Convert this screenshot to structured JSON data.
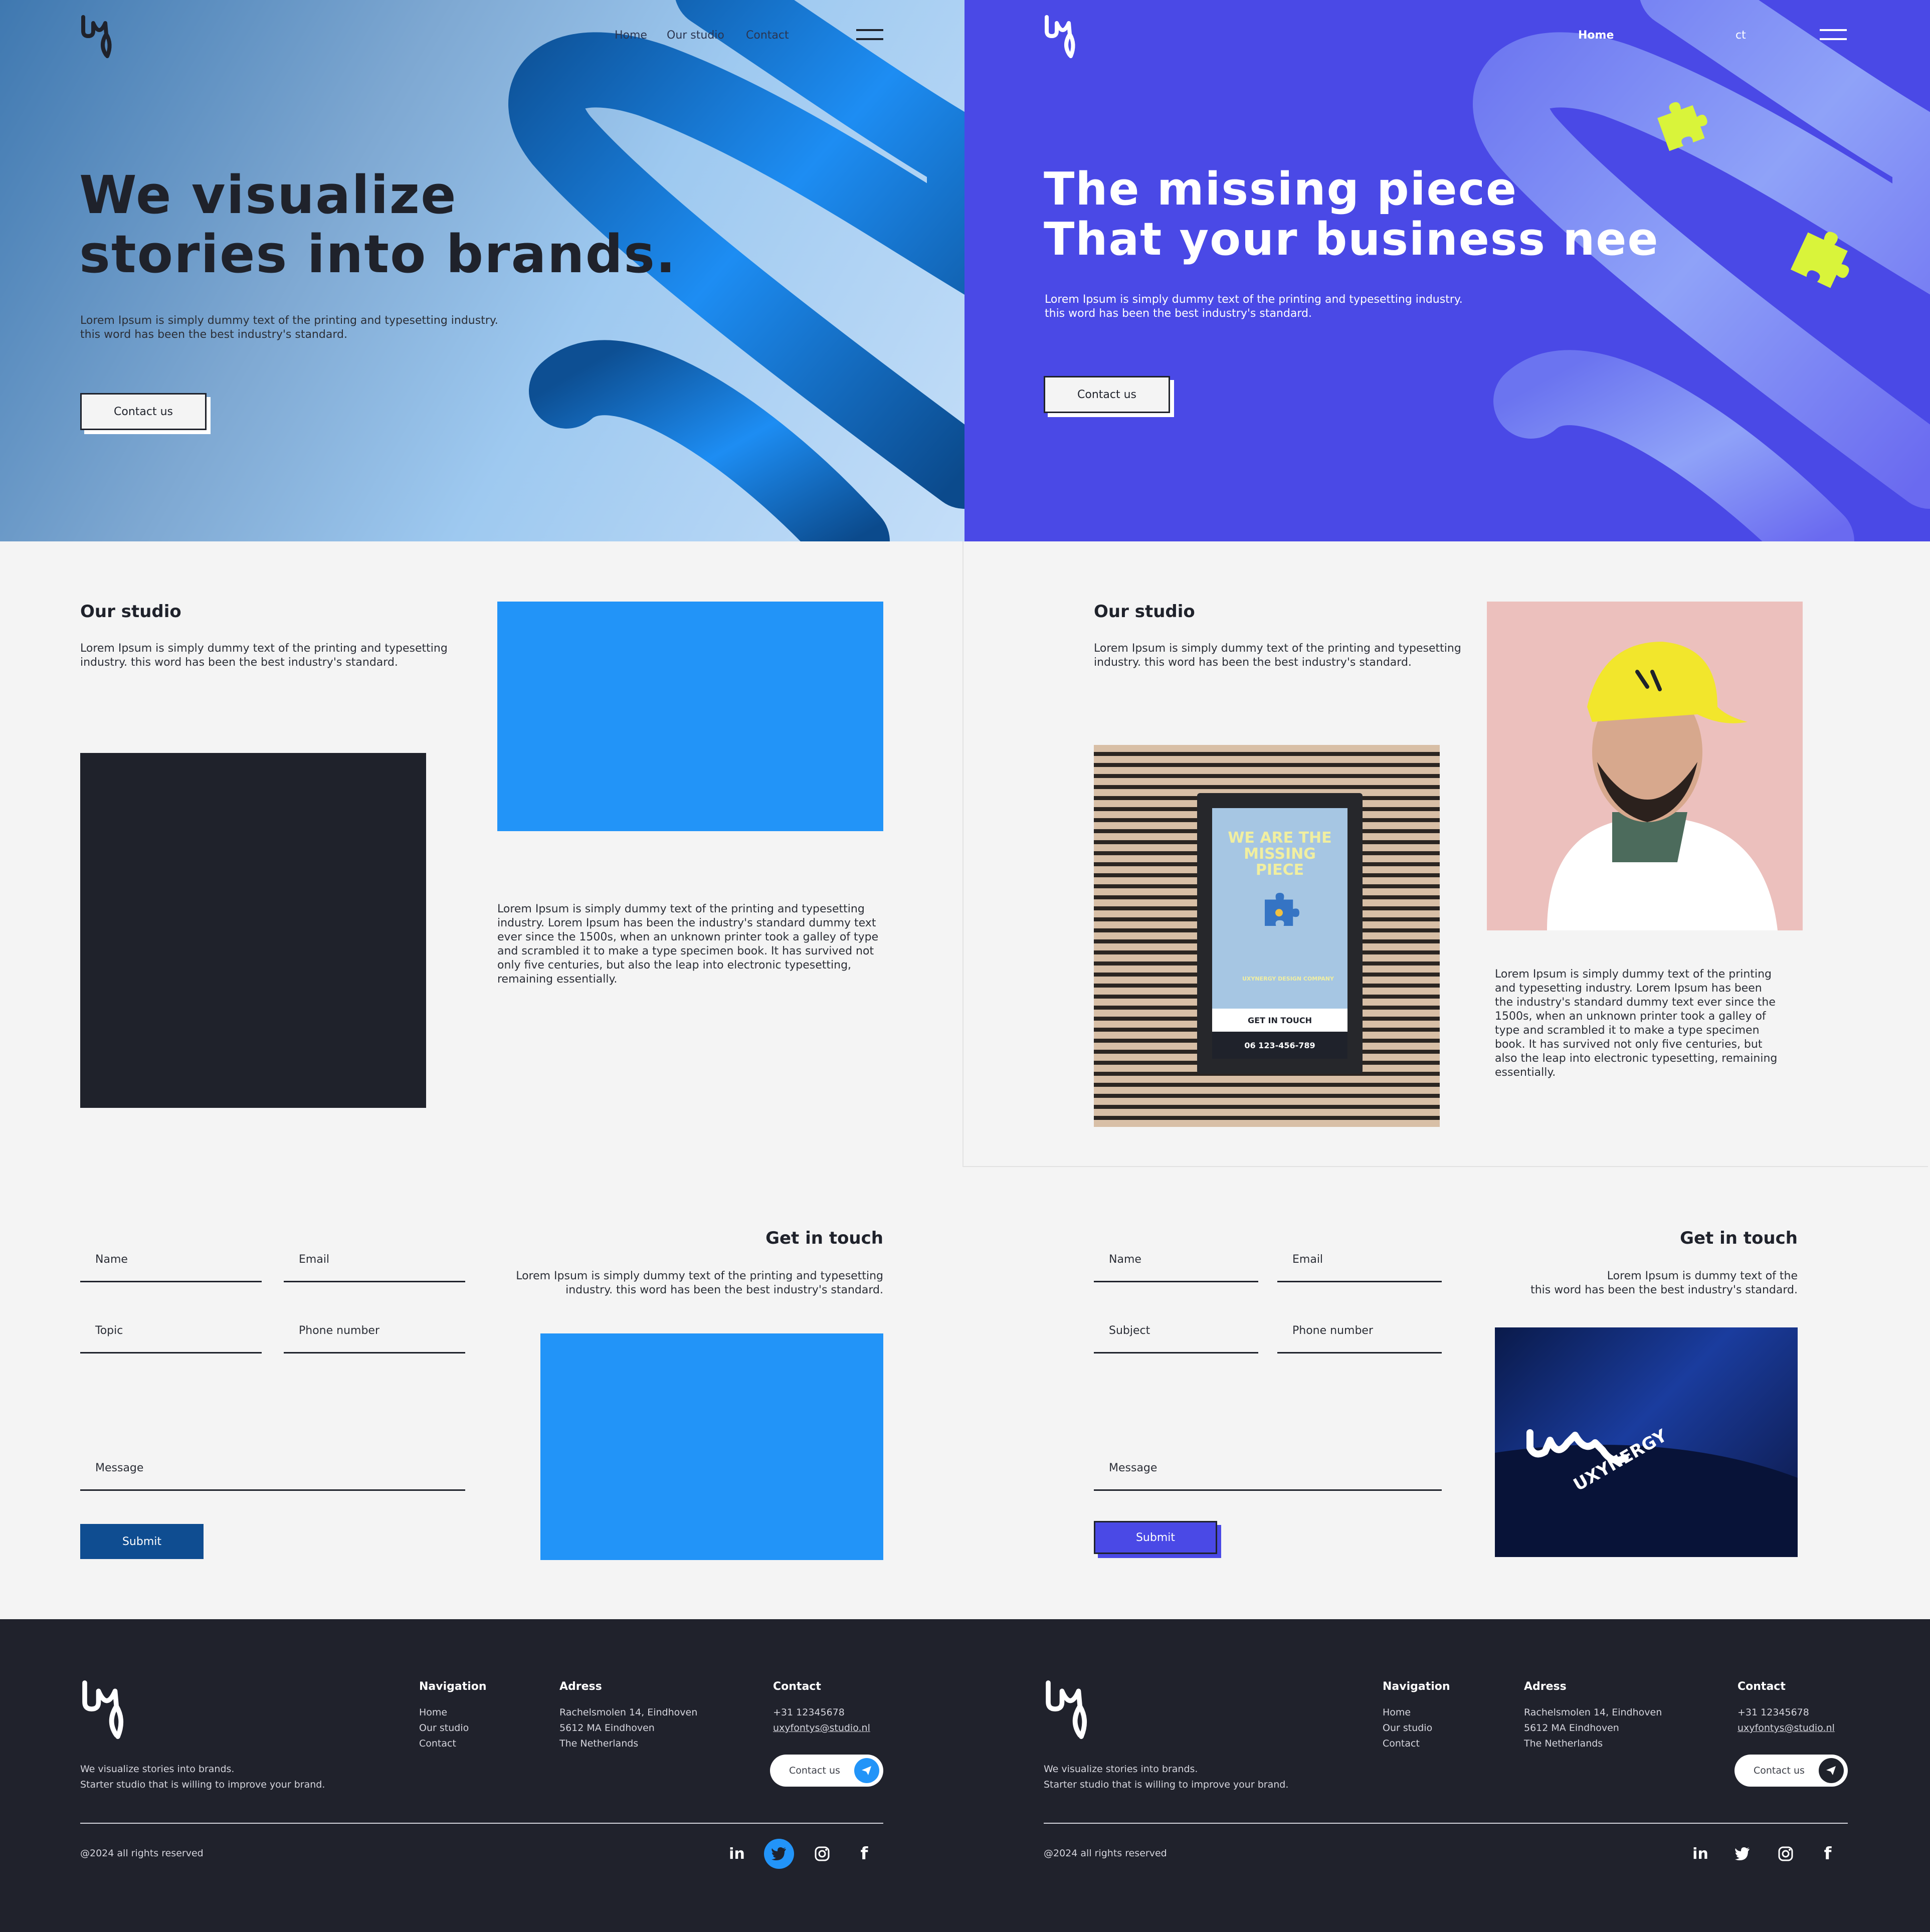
{
  "brand": {
    "logo": "uxy"
  },
  "colors": {
    "dark": "#1f222b",
    "blue": "#2294f8",
    "navy": "#0f4d91",
    "purple": "#4a49e6",
    "lime": "#d9f43a"
  },
  "left": {
    "nav": {
      "home": "Home",
      "studio": "Our studio",
      "contact": "Contact"
    },
    "hero": {
      "line1": "We visualize",
      "line2": "stories into brands.",
      "body1": "Lorem Ipsum is simply dummy text of the printing and typesetting industry.",
      "body2": "this word has been the best industry's standard.",
      "cta": "Contact us"
    },
    "studio": {
      "title": "Our studio",
      "body1": "Lorem Ipsum is simply dummy text of the printing and typesetting",
      "body2": "industry. this word has been the best industry's standard.",
      "long": "Lorem Ipsum is simply dummy text of the printing and typesetting industry. Lorem Ipsum has been the industry's standard dummy text ever since the 1500s, when an unknown printer took a galley of type and scrambled it to make a type specimen book. It has survived not only five centuries, but also the leap into electronic typesetting, remaining essentially."
    },
    "form": {
      "name": "Name",
      "email": "Email",
      "topic": "Topic",
      "phone": "Phone number",
      "message": "Message",
      "submit": "Submit"
    },
    "touch": {
      "title": "Get in touch",
      "body1": "Lorem Ipsum is simply dummy text of the printing and typesetting",
      "body2": "industry. this word has been the best industry's standard."
    }
  },
  "right": {
    "nav": {
      "home": "Home",
      "contact_fragment": "ct"
    },
    "hero": {
      "line1": "The missing piece",
      "line2": "That your business nee",
      "body1": "Lorem Ipsum is simply dummy text of the printing and typesetting industry.",
      "body2": "this word has been the best industry's standard.",
      "cta": "Contact us"
    },
    "studio": {
      "title": "Our studio",
      "body1": "Lorem Ipsum is simply dummy text of the printing and typesetting",
      "body2": "industry. this word has been the best industry's standard.",
      "long": "Lorem Ipsum is simply dummy text of the printing and typesetting industry. Lorem Ipsum has been the industry's standard dummy text ever since the 1500s, when an unknown printer took a galley of type and scrambled it to make a type specimen book. It has survived not only five centuries, but also the leap into electronic typesetting, remaining essentially."
    },
    "poster": {
      "headline": "WE ARE THE MISSING PIECE",
      "company": "UXYNERGY DESIGN COMPANY",
      "cta": "GET IN TOUCH",
      "phone": "06 123-456-789"
    },
    "form": {
      "name": "Name",
      "email": "Email",
      "subject": "Subject",
      "phone": "Phone number",
      "message": "Message",
      "submit": "Submit"
    },
    "touch": {
      "title": "Get in touch",
      "body1": "Lorem Ipsum is dummy text of the",
      "body2": "this word has been the best industry's standard."
    },
    "card": {
      "brand": "UXYNERGY"
    }
  },
  "footer": {
    "tagline1": "We visualize stories into brands.",
    "tagline2": "Starter studio that is willing to improve your brand.",
    "nav_title": "Navigation",
    "nav_items": [
      "Home",
      "Our studio",
      "Contact"
    ],
    "address_title": "Adress",
    "address_lines": [
      "Rachelsmolen 14, Eindhoven",
      "5612 MA Eindhoven",
      "The Netherlands"
    ],
    "contact_title": "Contact",
    "phone": "+31 12345678",
    "email": "uxyfontys@studio.nl",
    "contact_btn": "Contact us",
    "copyright": "@2024 all rights reserved",
    "social": [
      "linkedin-icon",
      "twitter-icon",
      "instagram-icon",
      "facebook-icon"
    ]
  }
}
